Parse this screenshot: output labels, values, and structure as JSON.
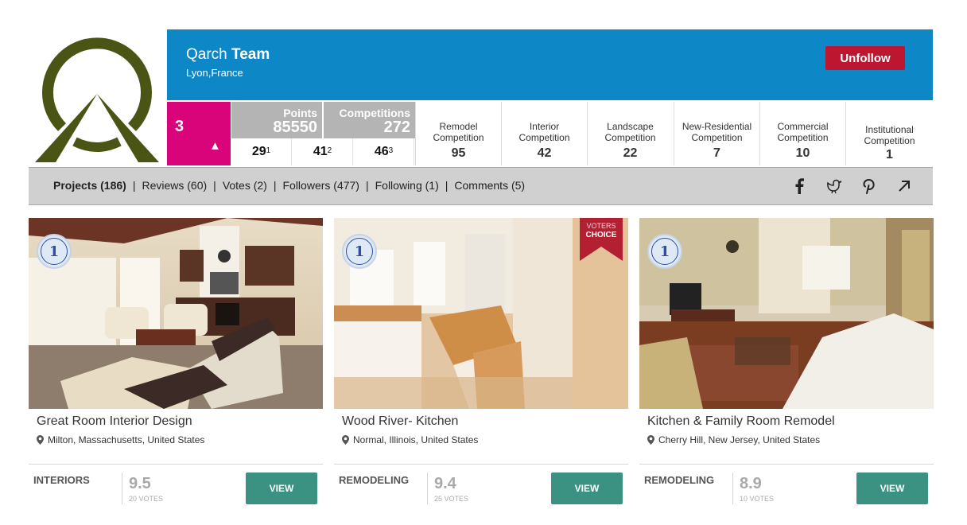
{
  "profile": {
    "name_light": "Qarch",
    "name_bold": "Team",
    "location": "Lyon,France",
    "unfollow_label": "Unfollow",
    "logo_color": "#4a5515"
  },
  "stats": {
    "rank": "3",
    "rank_trend_icon": "▲",
    "points_label": "Points",
    "points_value": "85550",
    "competitions_label": "Competitions",
    "competitions_value": "272",
    "placements": [
      {
        "count": "29",
        "place": "1"
      },
      {
        "count": "41",
        "place": "2"
      },
      {
        "count": "46",
        "place": "3"
      }
    ],
    "categories": [
      {
        "name_line1": "Remodel",
        "name_line2": "Competition",
        "value": "95"
      },
      {
        "name_line1": "Interior",
        "name_line2": "Competition",
        "value": "42"
      },
      {
        "name_line1": "Landscape",
        "name_line2": "Competition",
        "value": "22"
      },
      {
        "name_line1": "New-Residential",
        "name_line2": "Competition",
        "value": "7"
      },
      {
        "name_line1": "Commercial",
        "name_line2": "Competition",
        "value": "10"
      },
      {
        "name_line1": "Institutional",
        "name_line2": "Competition",
        "value": "1"
      }
    ]
  },
  "nav": {
    "tabs": [
      {
        "label": "Projects (186)"
      },
      {
        "label": "Reviews (60)"
      },
      {
        "label": "Votes (2)"
      },
      {
        "label": "Followers (477)"
      },
      {
        "label": "Following (1)"
      },
      {
        "label": "Comments (5)"
      }
    ],
    "separator": "|",
    "social_icons": [
      "facebook-icon",
      "twitter-icon",
      "pinterest-icon",
      "share-arrow-icon"
    ]
  },
  "projects": [
    {
      "title": "Great Room Interior Design",
      "location": "Milton, Massachusetts, United States",
      "category": "INTERIORS",
      "score": "9.5",
      "votes": "20 VOTES",
      "view_label": "VIEW",
      "badge": "first-place-cambridge",
      "badge_number": "1"
    },
    {
      "title": "Wood River- Kitchen",
      "location": "Normal, Illinois, United States",
      "category": "REMODELING",
      "score": "9.4",
      "votes": "25 VOTES",
      "view_label": "VIEW",
      "badge": "first-place-cambridge",
      "badge_number": "1",
      "ribbon_line1": "VOTERS",
      "ribbon_line2": "CHOICE"
    },
    {
      "title": "Kitchen & Family Room Remodel",
      "location": "Cherry Hill, New Jersey, United States",
      "category": "REMODELING",
      "score": "8.9",
      "votes": "10 VOTES",
      "view_label": "VIEW",
      "badge": "first-place-cambridge",
      "badge_number": "1"
    }
  ],
  "colors": {
    "header_blue": "#0d87c6",
    "unfollow_red": "#bc1630",
    "rank_magenta": "#d9037a",
    "stat_gray": "#b4b4b4",
    "view_teal": "#3b9182"
  }
}
